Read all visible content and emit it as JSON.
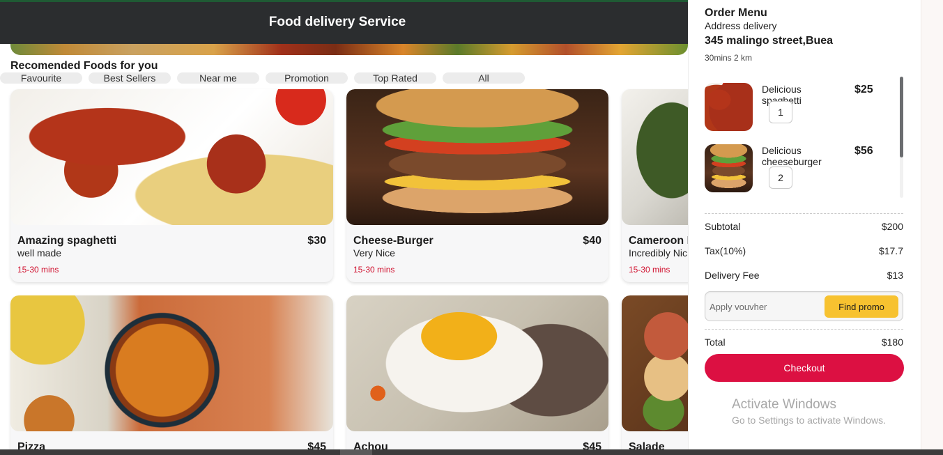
{
  "header": {
    "title": "Food delivery Service"
  },
  "section": {
    "title": "Recomended Foods for you"
  },
  "categories": [
    "Favourite",
    "Best Sellers",
    "Near me",
    "Promotion",
    "Top Rated",
    "All"
  ],
  "foods": [
    {
      "name": "Amazing spaghetti",
      "price": "$30",
      "desc": "well made",
      "time": "15-30 mins"
    },
    {
      "name": "Cheese-Burger",
      "price": "$40",
      "desc": "Very Nice",
      "time": "15-30 mins"
    },
    {
      "name": "Cameroon I",
      "desc": "Incredibly Nic",
      "time": "15-30 mins"
    },
    {
      "name": "Pizza",
      "price": "$45"
    },
    {
      "name": "Achou",
      "price": "$45"
    },
    {
      "name": "Salade"
    }
  ],
  "order": {
    "title": "Order Menu",
    "subtitle": "Address delivery",
    "address": "345 malingo street,Buea",
    "eta": "30mins 2 km",
    "items": [
      {
        "name": "Delicious spaghetti",
        "price": "$25",
        "qty": "1"
      },
      {
        "name": "Delicious cheeseburger",
        "price": "$56",
        "qty": "2"
      }
    ],
    "subtotal_label": "Subtotal",
    "subtotal": "$200",
    "tax_label": "Tax(10%)",
    "tax": "$17.7",
    "delivery_label": "Delivery Fee",
    "delivery": "$13",
    "voucher_placeholder": "Apply vouvher",
    "promo_label": "Find promo",
    "total_label": "Total",
    "total": "$180",
    "checkout_label": "Checkout"
  },
  "watermark": {
    "title": "Activate Windows",
    "subtitle": "Go to Settings to activate Windows."
  },
  "colors": {
    "header": "#2b2d2f",
    "accent": "#dc1042",
    "promo": "#f7c230",
    "time": "#d0102e"
  }
}
